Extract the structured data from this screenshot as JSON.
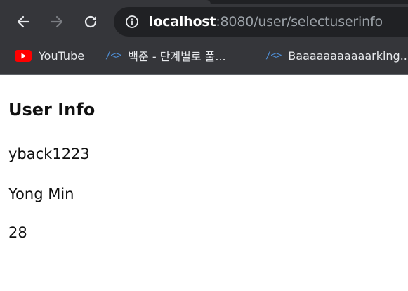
{
  "browser": {
    "omnibox": {
      "host": "localhost",
      "path": ":8080/user/selectuserinfo"
    },
    "bookmarks": [
      {
        "label": "YouTube",
        "icon": "youtube-icon"
      },
      {
        "label": "백준 - 단계별로 풀...",
        "icon": "code-icon"
      },
      {
        "label": "Baaaaaaaaaaarking...",
        "icon": "code-icon"
      }
    ],
    "colors": {
      "chrome_bg": "#35363a",
      "omnibox_bg": "#202124",
      "bookmark_code_icon": "#4f8fd6",
      "youtube_red": "#ff0000"
    }
  },
  "page": {
    "heading": "User Info",
    "user_id": "yback1223",
    "user_name": "Yong Min",
    "user_age": "28"
  }
}
